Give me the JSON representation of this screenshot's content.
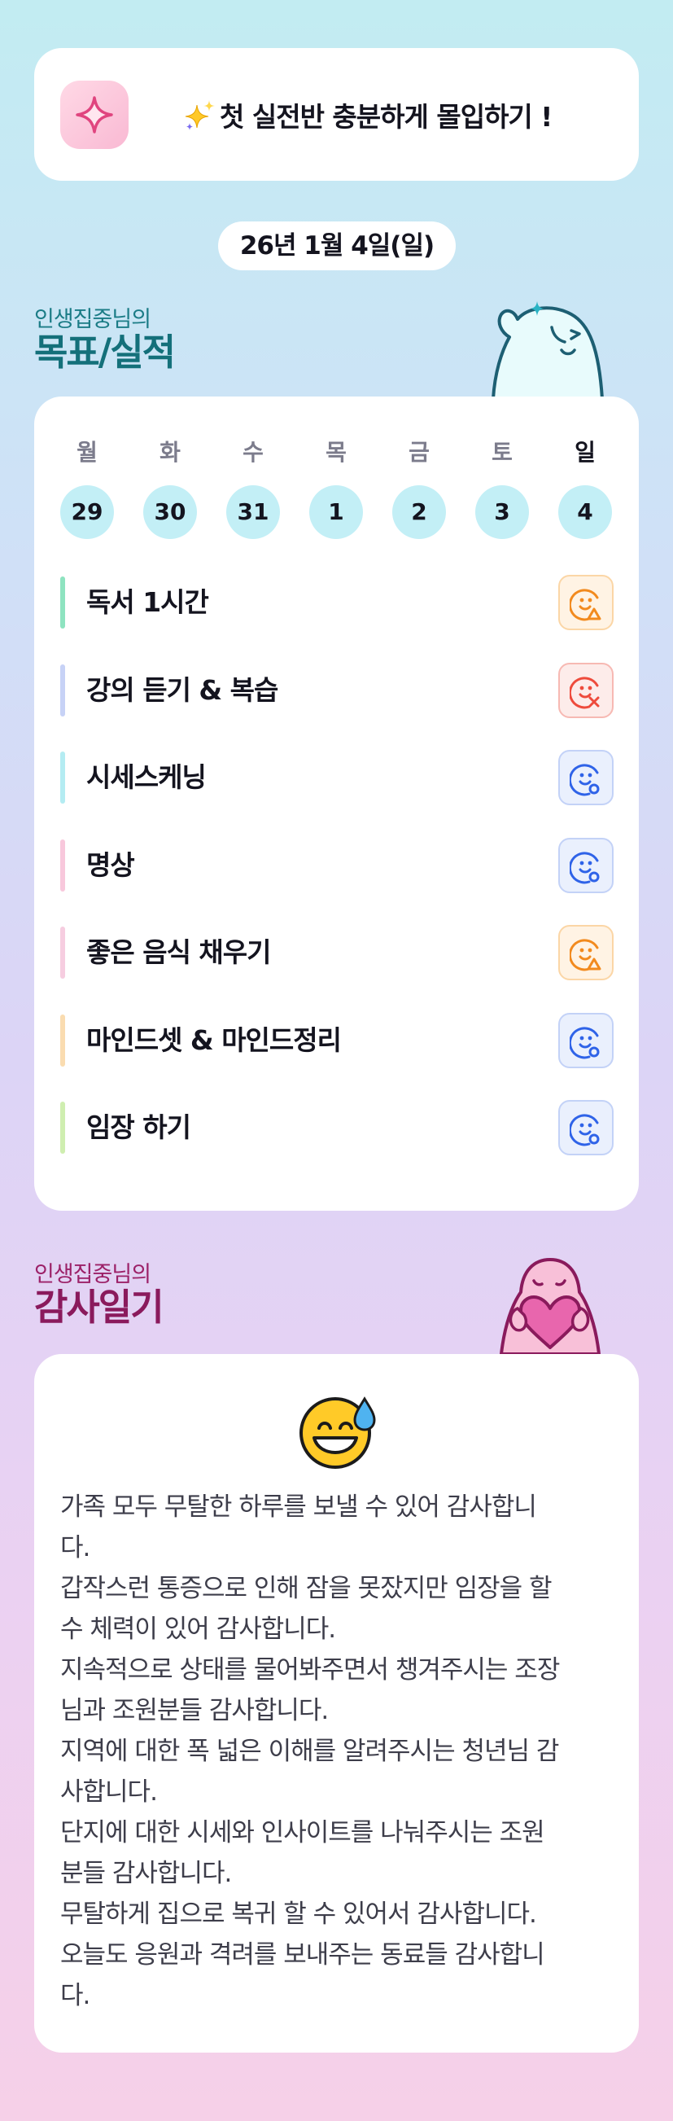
{
  "mission": {
    "icon": "sparkle-icon",
    "emoji": "sparkles-emoji",
    "text": "첫 실전반 충분하게 몰입하기 !"
  },
  "date": "26년 1월 4일(일)",
  "goals_section": {
    "subtitle": "인생집중님의",
    "title": "목표/실적"
  },
  "week": {
    "days": [
      {
        "label": "월",
        "date": "29"
      },
      {
        "label": "화",
        "date": "30"
      },
      {
        "label": "수",
        "date": "31"
      },
      {
        "label": "목",
        "date": "1"
      },
      {
        "label": "금",
        "date": "2"
      },
      {
        "label": "토",
        "date": "3"
      },
      {
        "label": "일",
        "date": "4"
      }
    ],
    "selected_index": 6
  },
  "goals": [
    {
      "label": "독서 1시간",
      "status": "partial",
      "bar_color": "#8ee3c0",
      "icon": "smile-triangle-icon"
    },
    {
      "label": "강의 듣기 & 복습",
      "status": "failed",
      "bar_color": "#c7d2f6",
      "icon": "smile-x-icon"
    },
    {
      "label": "시세스케닝",
      "status": "done",
      "bar_color": "#b4ecf2",
      "icon": "smile-circle-icon"
    },
    {
      "label": "명상",
      "status": "done",
      "bar_color": "#f8c8dc",
      "icon": "smile-circle-icon"
    },
    {
      "label": "좋은 음식 채우기",
      "status": "partial",
      "bar_color": "#f6cde0",
      "icon": "smile-triangle-icon"
    },
    {
      "label": "마인드셋 & 마인드정리",
      "status": "done",
      "bar_color": "#fadcb0",
      "icon": "smile-circle-icon"
    },
    {
      "label": "임장 하기",
      "status": "done",
      "bar_color": "#cfeeb0",
      "icon": "smile-circle-icon"
    }
  ],
  "status_colors": {
    "partial": {
      "stroke": "#f28a1e",
      "bg": "#fff3e4",
      "border": "#fbd6a6"
    },
    "failed": {
      "stroke": "#ee4b3c",
      "bg": "#fdecea",
      "border": "#f7b9b3"
    },
    "done": {
      "stroke": "#2f63e8",
      "bg": "#eaf0fd",
      "border": "#c3d2f7"
    }
  },
  "gratitude_section": {
    "subtitle": "인생집중님의",
    "title": "감사일기"
  },
  "gratitude": {
    "emoji": "grinning-sweat-emoji",
    "lines": [
      "가족 모두 무탈한 하루를 보낼 수 있어 감사합니",
      "다.",
      "갑작스런 통증으로 인해 잠을 못잤지만 임장을 할",
      "수 체력이 있어 감사합니다.",
      "지속적으로 상태를 물어봐주면서 챙겨주시는 조장",
      "님과 조원분들 감사합니다.",
      "지역에 대한 폭 넓은 이해를 알려주시는 청년님 감",
      "사합니다.",
      "단지에 대한 시세와 인사이트를 나눠주시는 조원",
      "분들 감사합니다.",
      "무탈하게 집으로 복귀 할 수 있어서 감사합니다.",
      "오늘도 응원과 격려를 보내주는 동료들 감사합니",
      "다."
    ]
  },
  "colors": {
    "accent_teal": "#14707a",
    "accent_magenta": "#8a1a5c",
    "day_circle": "#c3eff6"
  }
}
